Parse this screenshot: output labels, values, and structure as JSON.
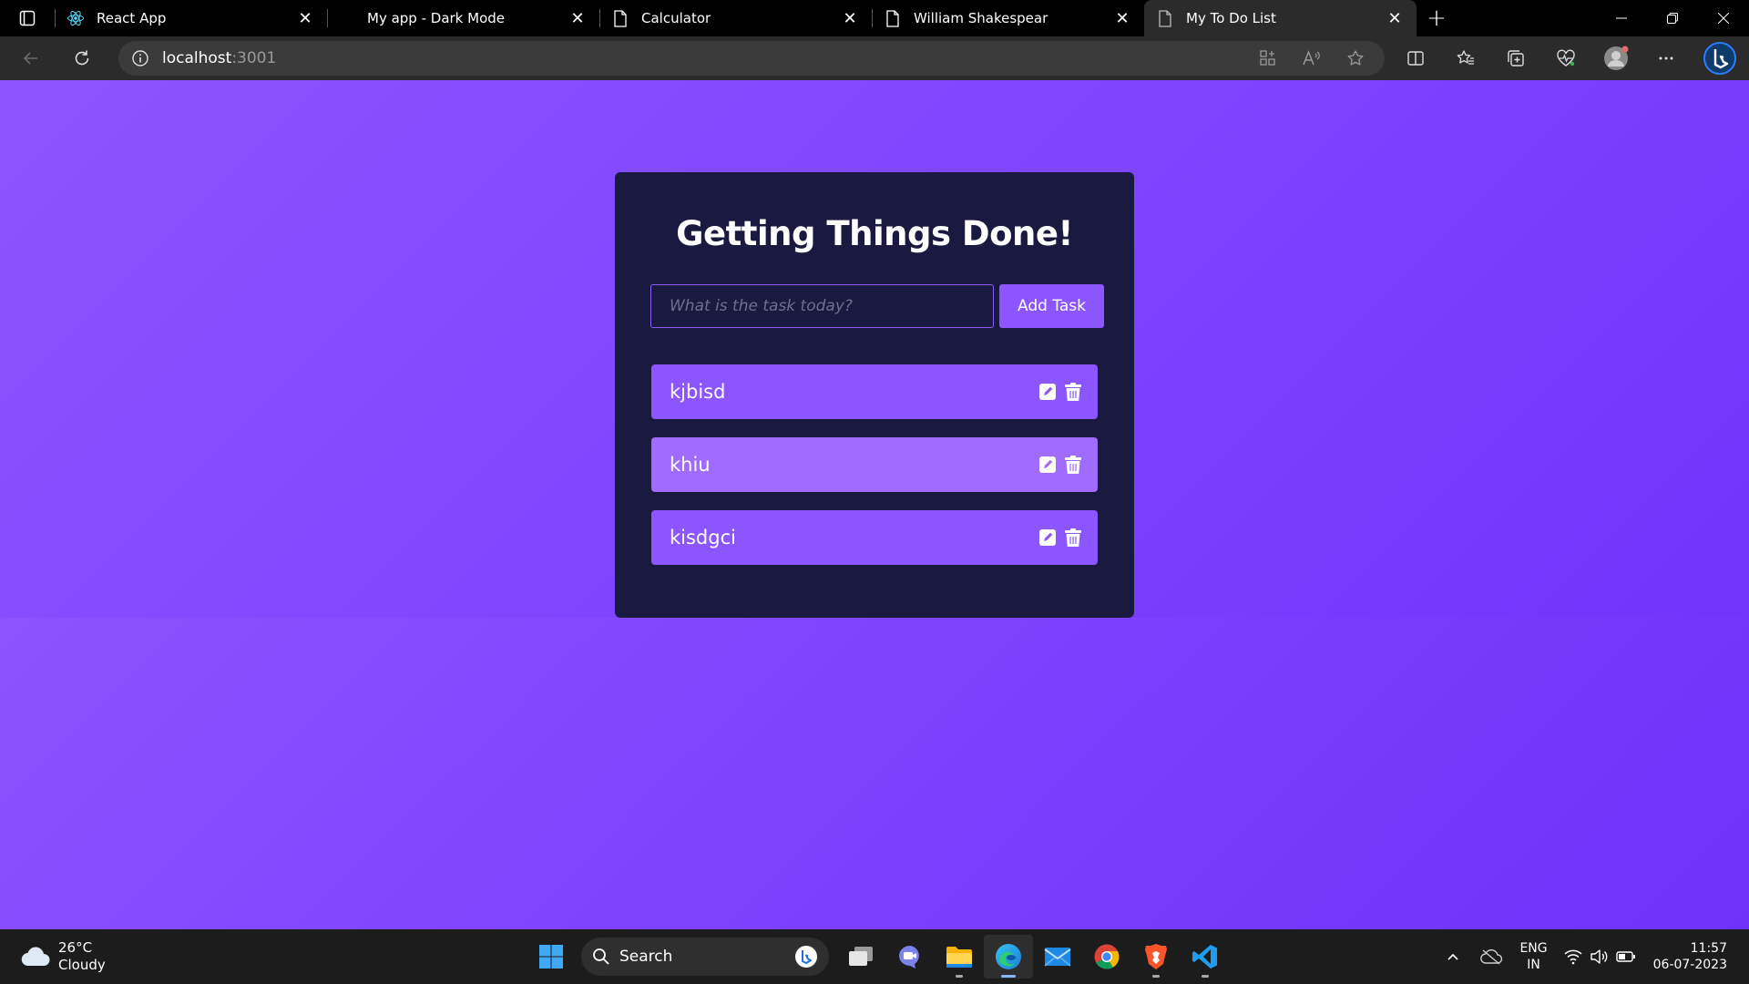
{
  "browser": {
    "tabs": [
      {
        "title": "React App",
        "icon": "react-icon",
        "active": false
      },
      {
        "title": "My app - Dark Mode",
        "icon": "none",
        "active": false
      },
      {
        "title": "Calculator",
        "icon": "page-icon",
        "active": false
      },
      {
        "title": "William Shakespear",
        "icon": "page-icon",
        "active": false
      },
      {
        "title": "My To Do List",
        "icon": "page-icon",
        "active": true
      }
    ],
    "address": {
      "host": "localhost",
      "port": ":3001"
    },
    "accent": "#8b55ff"
  },
  "app": {
    "title": "Getting Things Done!",
    "input": {
      "placeholder": "What is the task today?",
      "value": ""
    },
    "add_button_label": "Add Task",
    "todos": [
      {
        "text": "kjbisd"
      },
      {
        "text": "khiu"
      },
      {
        "text": "kisdgci"
      }
    ],
    "colors": {
      "background": "#7f46ff",
      "card": "#1a1a40",
      "item": "#8b55ff",
      "item_hover": "#a06bff"
    }
  },
  "taskbar": {
    "weather": {
      "temp": "26°C",
      "condition": "Cloudy"
    },
    "search_label": "Search",
    "language": {
      "line1": "ENG",
      "line2": "IN"
    },
    "clock": {
      "time": "11:57",
      "date": "06-07-2023"
    }
  }
}
